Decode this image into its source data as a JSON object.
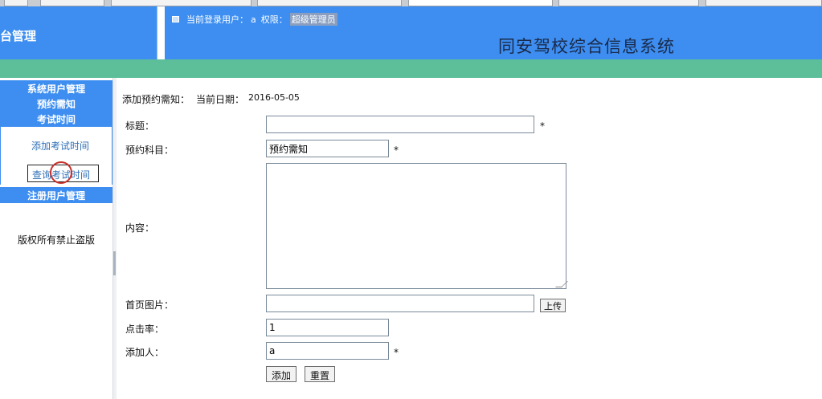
{
  "header": {
    "left_title": "台管理",
    "login_label": "当前登录用户：",
    "login_user": "a",
    "role_label": "权限：",
    "role_value": "超级管理员",
    "system_title": "同安驾校综合信息系统"
  },
  "sidebar": {
    "heads": [
      "系统用户管理",
      "预约需知",
      "考试时间"
    ],
    "link_add": "添加考试时间",
    "link_query": "查询考试时间",
    "head_bottom": "注册用户管理",
    "copyright": "版权所有禁止盗版"
  },
  "form": {
    "heading": "添加预约需知：",
    "date_label": "当前日期：",
    "date_value": "2016-05-05",
    "title_label": "标题：",
    "title_value": "",
    "subject_label": "预约科目：",
    "subject_value": "预约需知",
    "content_label": "内容：",
    "image_label": "首页图片：",
    "image_value": "",
    "upload_label": "上传",
    "clicks_label": "点击率：",
    "clicks_value": "1",
    "adder_label": "添加人：",
    "adder_value": "a",
    "required_mark": "*",
    "add_button": "添加",
    "reset_button": "重置"
  }
}
